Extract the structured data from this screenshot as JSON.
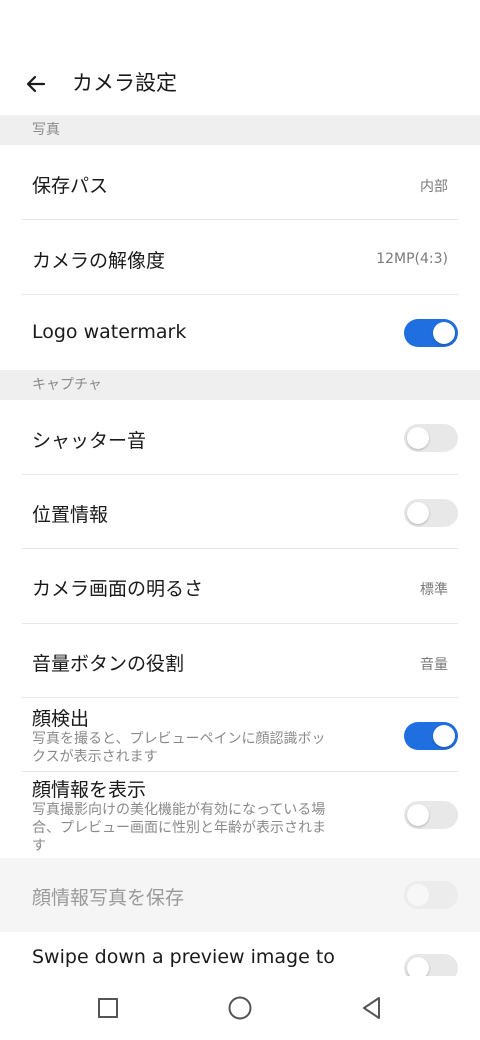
{
  "header": {
    "title": "カメラ設定"
  },
  "sections": {
    "photo": "写真",
    "capture": "キャプチャ"
  },
  "settings": {
    "save_path": {
      "label": "保存パス",
      "value": "内部"
    },
    "resolution": {
      "label": "カメラの解像度",
      "value": "12MP(4:3)"
    },
    "logo_watermark": {
      "label": "Logo watermark",
      "state": "on"
    },
    "shutter_sound": {
      "label": "シャッター音",
      "state": "off"
    },
    "location": {
      "label": "位置情報",
      "state": "off"
    },
    "brightness": {
      "label": "カメラ画面の明るさ",
      "value": "標準"
    },
    "volume_button": {
      "label": "音量ボタンの役割",
      "value": "音量"
    },
    "face_detection": {
      "label": "顔検出",
      "description": "写真を撮ると、プレビューペインに顔認識ボックスが表示されます",
      "state": "on"
    },
    "face_info": {
      "label": "顔情報を表示",
      "description": "写真撮影向けの美化機能が有効になっている場合、プレビュー画面に性別と年齢が表示されます",
      "state": "off"
    },
    "save_face_info": {
      "label": "顔情報写真を保存",
      "state": "off",
      "enabled": false
    },
    "swipe_down": {
      "label": "Swipe down a preview image to",
      "state": "off"
    }
  },
  "navbar": {
    "icons": [
      "recents-square-icon",
      "home-circle-icon",
      "back-triangle-icon"
    ]
  },
  "colors": {
    "accent": "#1f6fe0",
    "section_bg": "#efefef"
  }
}
